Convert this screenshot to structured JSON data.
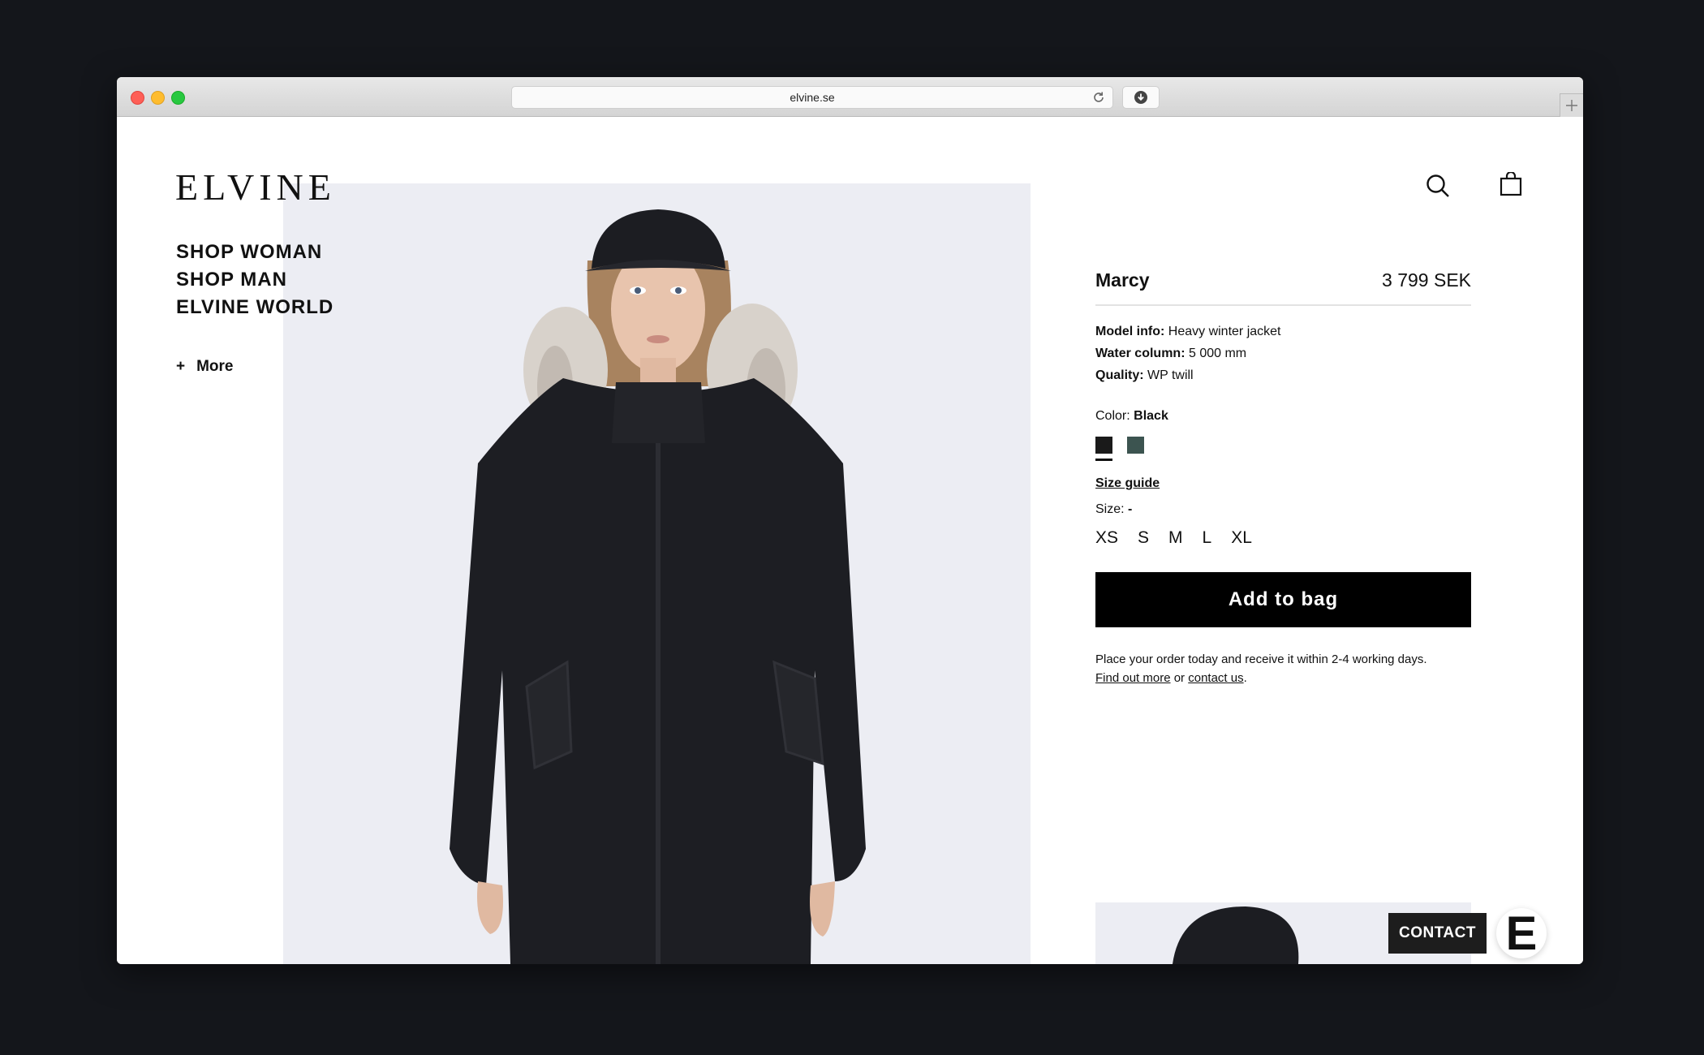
{
  "browser": {
    "url": "elvine.se"
  },
  "brand": {
    "logo": "ELVINE"
  },
  "nav": {
    "items": [
      "SHOP WOMAN",
      "SHOP MAN",
      "ELVINE WORLD"
    ],
    "more_label": "More",
    "more_icon": "+"
  },
  "product": {
    "name": "Marcy",
    "price": "3 799 SEK",
    "specs": [
      {
        "label": "Model info:",
        "value": "Heavy winter jacket"
      },
      {
        "label": "Water column:",
        "value": "5 000 mm"
      },
      {
        "label": "Quality:",
        "value": "WP twill"
      }
    ],
    "color_label": "Color:",
    "color_value": "Black",
    "swatches": [
      {
        "name": "Black",
        "color": "#1a1a1a",
        "selected": true
      },
      {
        "name": "Dark green",
        "color": "#3c5450",
        "selected": false
      }
    ],
    "size_guide_label": "Size guide",
    "size_label": "Size:",
    "size_value": "-",
    "sizes": [
      "XS",
      "S",
      "M",
      "L",
      "XL"
    ],
    "add_to_bag_label": "Add to bag",
    "delivery_text": "Place your order today and receive it within 2-4 working days.",
    "find_out_more_label": "Find out more",
    "or_text": "or",
    "contact_us_label": "contact us",
    "period": "."
  },
  "widgets": {
    "contact_label": "CONTACT",
    "badge_letter": "E"
  },
  "icons": {
    "search": "search-icon",
    "bag": "bag-icon",
    "reload": "reload-icon",
    "download": "download-icon"
  }
}
